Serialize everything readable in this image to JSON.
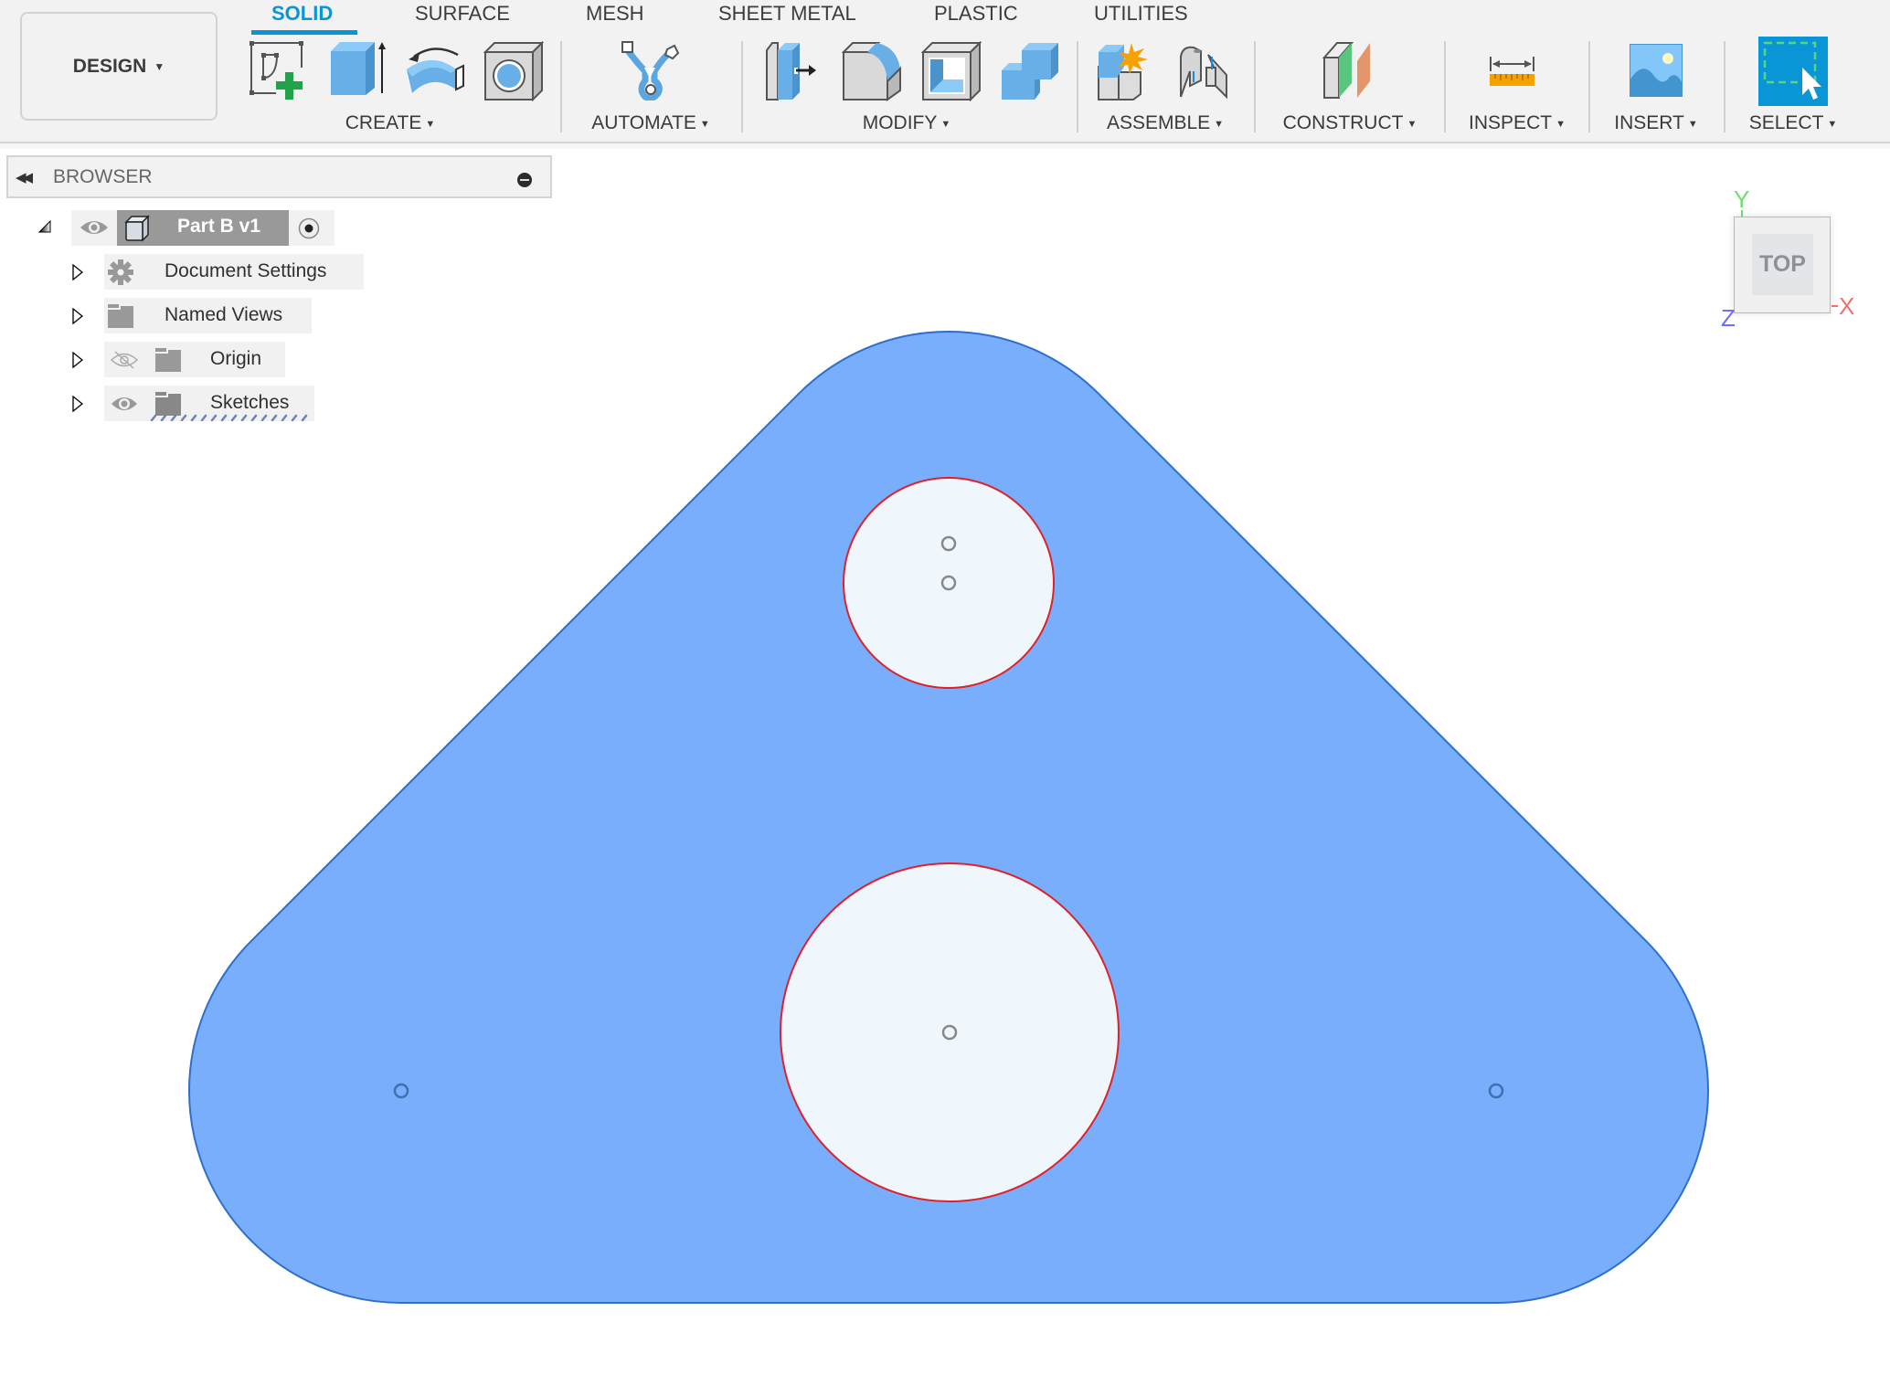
{
  "workspace": {
    "label": "DESIGN"
  },
  "tabs": [
    {
      "label": "SOLID",
      "active": true
    },
    {
      "label": "SURFACE",
      "active": false
    },
    {
      "label": "MESH",
      "active": false
    },
    {
      "label": "SHEET METAL",
      "active": false
    },
    {
      "label": "PLASTIC",
      "active": false
    },
    {
      "label": "UTILITIES",
      "active": false
    }
  ],
  "groups": [
    {
      "label": "CREATE",
      "icons": [
        "create-sketch-icon",
        "extrude-icon",
        "revolve-icon",
        "hole-icon"
      ]
    },
    {
      "label": "AUTOMATE",
      "icons": [
        "automate-icon"
      ]
    },
    {
      "label": "MODIFY",
      "icons": [
        "press-pull-icon",
        "fillet-icon",
        "shell-icon",
        "combine-icon"
      ]
    },
    {
      "label": "ASSEMBLE",
      "icons": [
        "new-component-icon",
        "joint-icon"
      ]
    },
    {
      "label": "CONSTRUCT",
      "icons": [
        "offset-plane-icon"
      ]
    },
    {
      "label": "INSPECT",
      "icons": [
        "measure-icon"
      ]
    },
    {
      "label": "INSERT",
      "icons": [
        "insert-image-icon"
      ]
    },
    {
      "label": "SELECT",
      "icons": [
        "window-select-icon"
      ]
    }
  ],
  "browser": {
    "title": "BROWSER",
    "root": {
      "label": "Part B v1",
      "visible": true
    },
    "items": [
      {
        "label": "Document Settings",
        "icon": "gear-icon"
      },
      {
        "label": "Named Views",
        "icon": "folder-icon"
      },
      {
        "label": "Origin",
        "icon": "folder-icon",
        "visible": false
      },
      {
        "label": "Sketches",
        "icon": "folder-icon",
        "visible": true
      }
    ]
  },
  "viewcube": {
    "face": "TOP",
    "axes": {
      "x": "X",
      "y": "Y",
      "z": "Z"
    }
  },
  "colors": {
    "accent": "#0a96d6",
    "body_fill": "#78aefc",
    "body_edge": "#2f6fcc",
    "hole_fill": "#f0f7fc",
    "hole_edge": "#e0202a",
    "axis_x": "#f07070",
    "axis_y": "#70dd70",
    "axis_z": "#6f6ff5"
  }
}
